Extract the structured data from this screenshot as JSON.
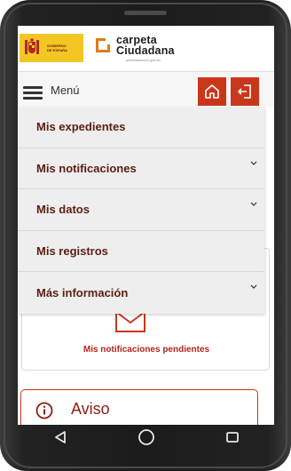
{
  "header": {
    "gov_logo_text": [
      "GOBIERNO",
      "DE ESPAÑA"
    ],
    "brand_line1": "carpeta",
    "brand_line2": "Ciudadana",
    "brand_sub": "administración.gob.es"
  },
  "navbar": {
    "menu_label": "Menú"
  },
  "menu": {
    "items": [
      {
        "label": "Mis expedientes",
        "expandable": false
      },
      {
        "label": "Mis notificaciones",
        "expandable": true
      },
      {
        "label": "Mis datos",
        "expandable": true
      },
      {
        "label": "Mis registros",
        "expandable": false
      },
      {
        "label": "Más información",
        "expandable": true
      }
    ]
  },
  "content": {
    "pending_label": "Mis notificaciones pendientes",
    "aviso_label": "Aviso"
  },
  "colors": {
    "accent": "#c9371b",
    "menu_text": "#5b1d12",
    "gov_yellow": "#f3c624"
  },
  "icons": {
    "menu": "hamburger-icon",
    "home": "home-icon",
    "exit": "logout-icon",
    "expand": "chevron-down-icon",
    "info": "info-icon",
    "back": "back-triangle-icon",
    "home_circle": "home-circle-icon",
    "recents": "recents-square-icon"
  }
}
